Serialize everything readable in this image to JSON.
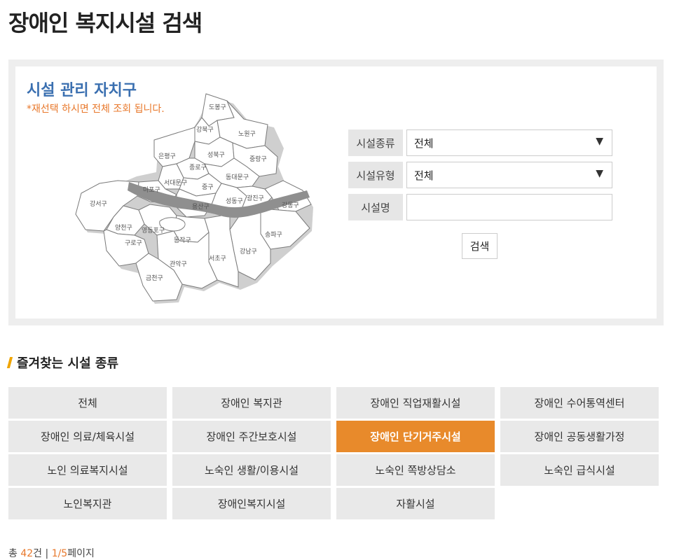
{
  "page": {
    "title": "장애인 복지시설 검색"
  },
  "map": {
    "heading": "시설 관리 자치구",
    "note": "*재선택 하시면 전체 조회 됩니다.",
    "districts": [
      "도봉구",
      "강북구",
      "노원구",
      "은평구",
      "성북구",
      "중랑구",
      "종로구",
      "서대문구",
      "동대문구",
      "마포구",
      "중구",
      "강서구",
      "성동구",
      "광진구",
      "용산구",
      "강동구",
      "양천구",
      "영등포구",
      "송파구",
      "구로구",
      "동작구",
      "강남구",
      "서초구",
      "관악구",
      "금천구"
    ]
  },
  "form": {
    "type_label": "시설종류",
    "type_value": "전체",
    "kind_label": "시설유형",
    "kind_value": "전체",
    "name_label": "시설명",
    "name_value": "",
    "search_button": "검색"
  },
  "favorites": {
    "heading": "즐겨찾는 시설 종류",
    "items": [
      "전체",
      "장애인 복지관",
      "장애인 직업재활시설",
      "장애인 수어통역센터",
      "장애인 의료/체육시설",
      "장애인 주간보호시설",
      "장애인 단기거주시설",
      "장애인 공동생활가정",
      "노인 의료복지시설",
      "노숙인 생활/이용시설",
      "노숙인 쪽방상담소",
      "노숙인 급식시설",
      "노인복지관",
      "장애인복지시설",
      "자활시설"
    ],
    "active_index": 6,
    "active_color": "#e88a2b"
  },
  "results": {
    "prefix": "총",
    "count": "42",
    "count_suffix": "건 |",
    "page": "1/5",
    "page_suffix": "페이지"
  },
  "colors": {
    "accent": "#e88a2b",
    "heading_blue": "#3a6fb0"
  }
}
